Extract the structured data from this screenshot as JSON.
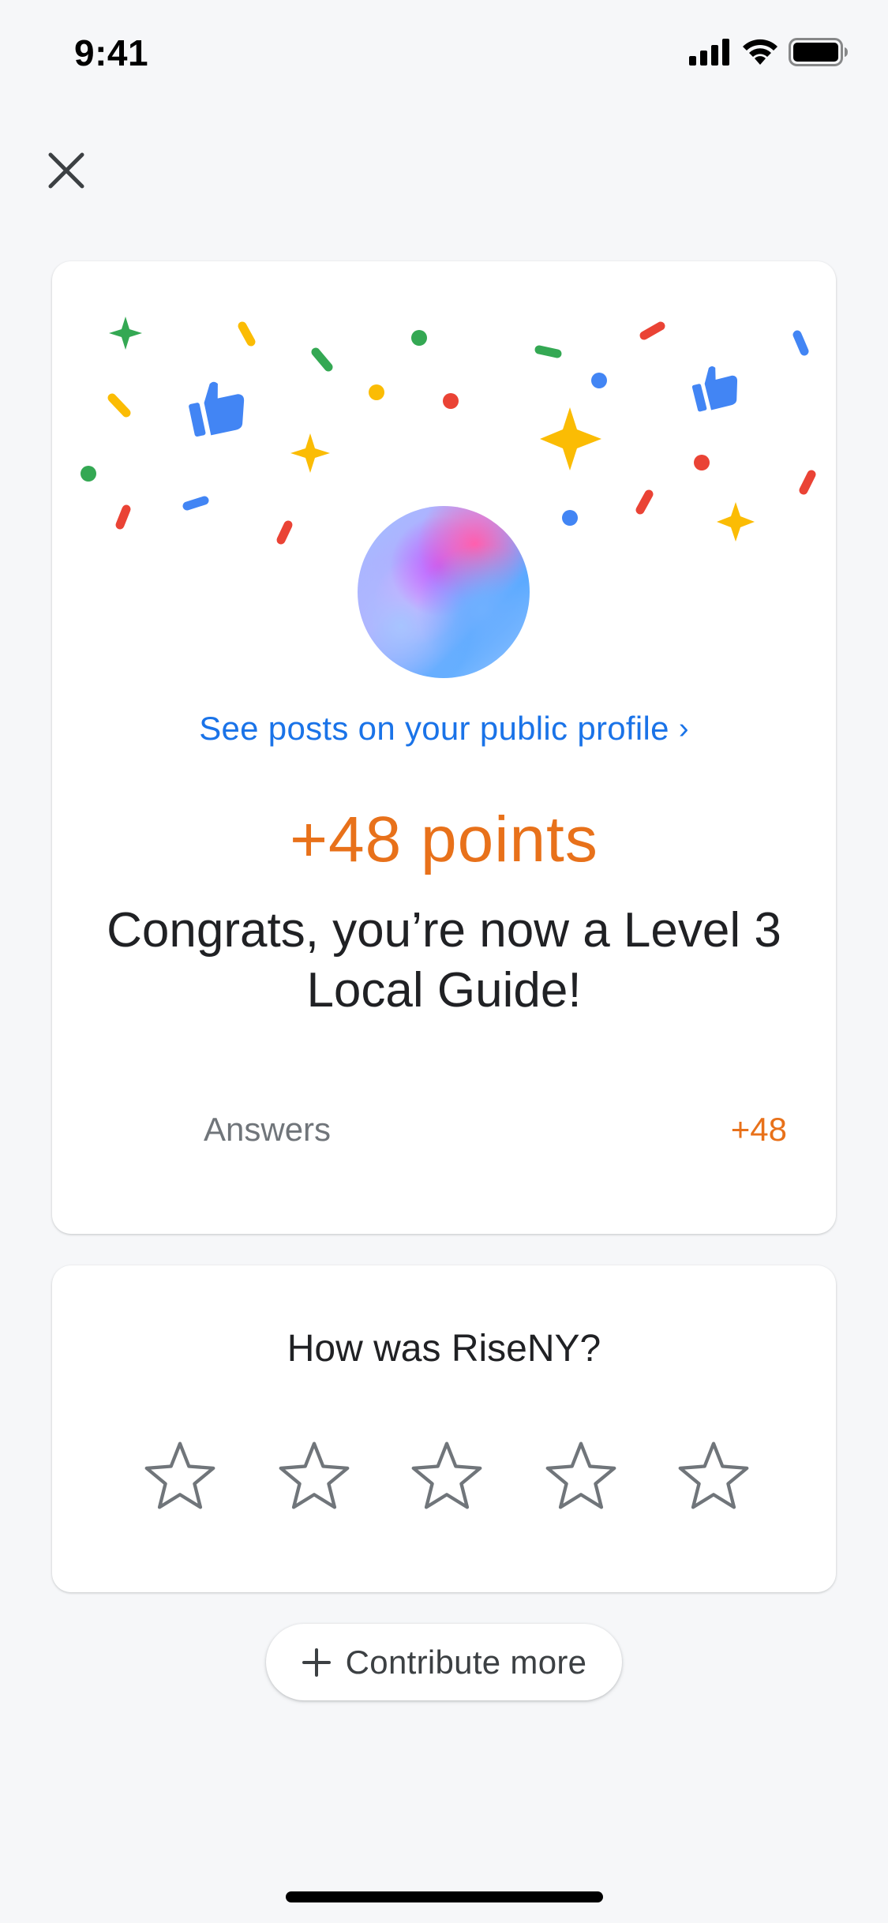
{
  "status_bar": {
    "time": "9:41",
    "icons": [
      "cellular-signal-icon",
      "wifi-icon",
      "battery-icon"
    ]
  },
  "header": {
    "close_icon": "close-icon"
  },
  "reward_card": {
    "profile_link": "See posts on your public profile",
    "points": "+48 points",
    "message": "Congrats, you’re now a Level 3 Local Guide!",
    "breakdown": [
      {
        "label": "Answers",
        "value": "+48"
      }
    ],
    "decoration_icons": [
      "sparkle-icon",
      "thumbs-up-icon",
      "confetti"
    ]
  },
  "rating_card": {
    "question": "How was RiseNY?",
    "stars": 5,
    "selected_rating": 0
  },
  "contribute_button": {
    "icon": "plus-icon",
    "label": "Contribute more"
  },
  "colors": {
    "accent_blue": "#1a73e8",
    "points_orange": "#e8711a",
    "confetti_green": "#34a853",
    "confetti_yellow": "#fbbc04",
    "confetti_red": "#ea4335",
    "confetti_blue": "#4285f4"
  }
}
